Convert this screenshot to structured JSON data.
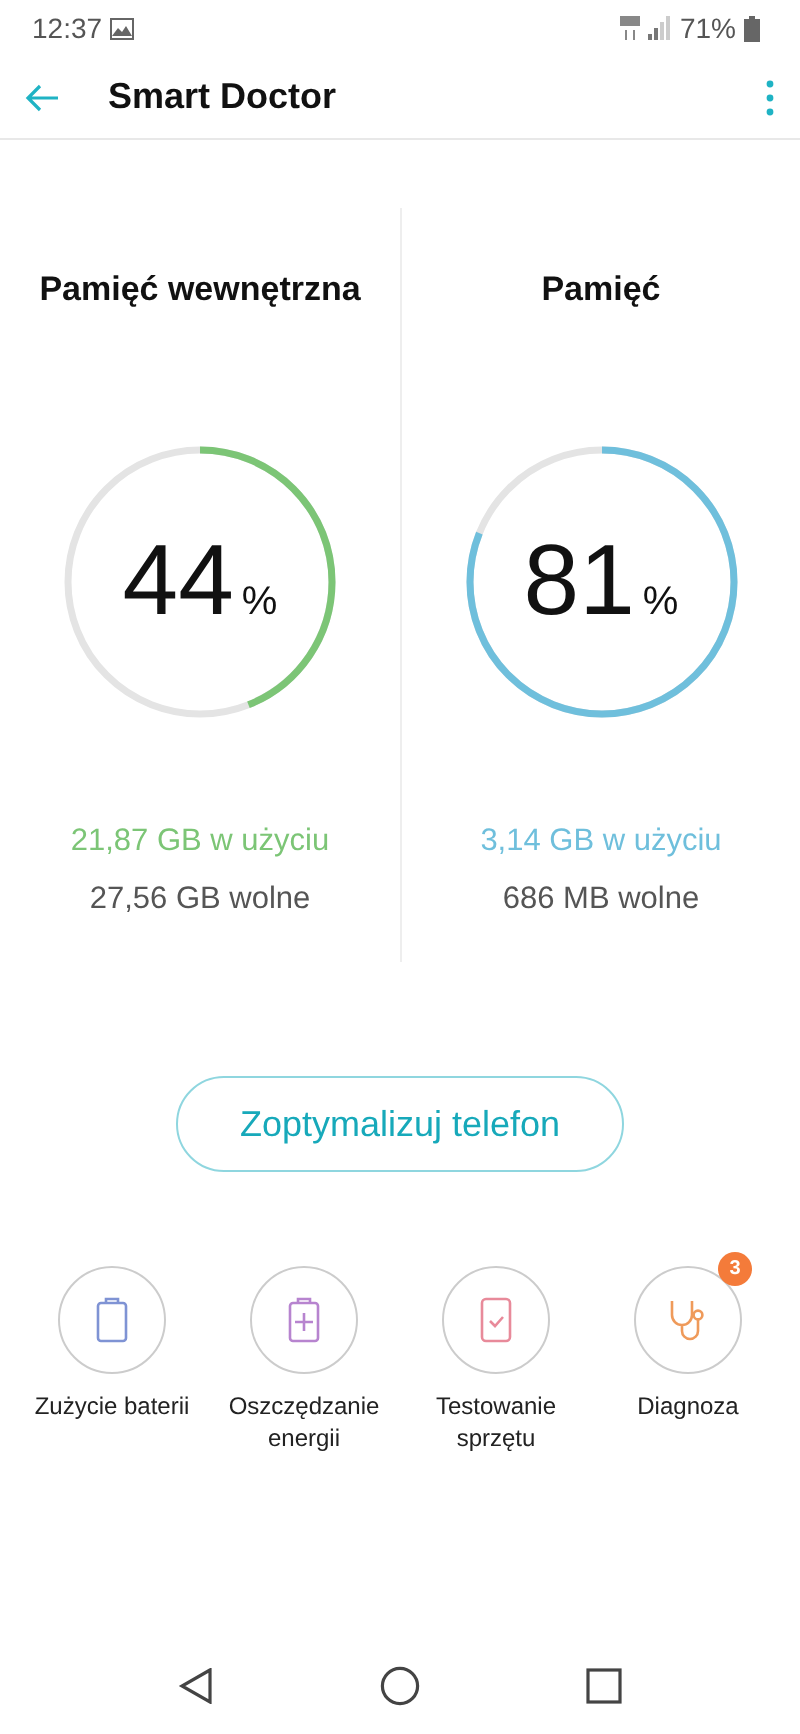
{
  "status_bar": {
    "time": "12:37",
    "battery": "71%"
  },
  "app_bar": {
    "title": "Smart Doctor"
  },
  "gauges": [
    {
      "title": "Pamięć wewnętrzna",
      "value": "44",
      "unit": "%",
      "color": "#7cc576",
      "used": "21,87 GB w użyciu",
      "free": "27,56 GB wolne"
    },
    {
      "title": "Pamięć",
      "value": "81",
      "unit": "%",
      "color": "#6fbfdc",
      "used": "3,14 GB w użyciu",
      "free": "686 MB wolne"
    }
  ],
  "optimize_button": "Zoptymalizuj telefon",
  "tools": [
    {
      "kind": "battery",
      "label": "Zużycie baterii",
      "color": "#7f93d4"
    },
    {
      "kind": "saver",
      "label": "Oszczędzanie energii",
      "color": "#b784cf"
    },
    {
      "kind": "phone",
      "label": "Testowanie sprzętu",
      "color": "#e88a9a"
    },
    {
      "kind": "stethoscope",
      "label": "Diagnoza",
      "color": "#ef9a5a",
      "badge": "3"
    }
  ]
}
